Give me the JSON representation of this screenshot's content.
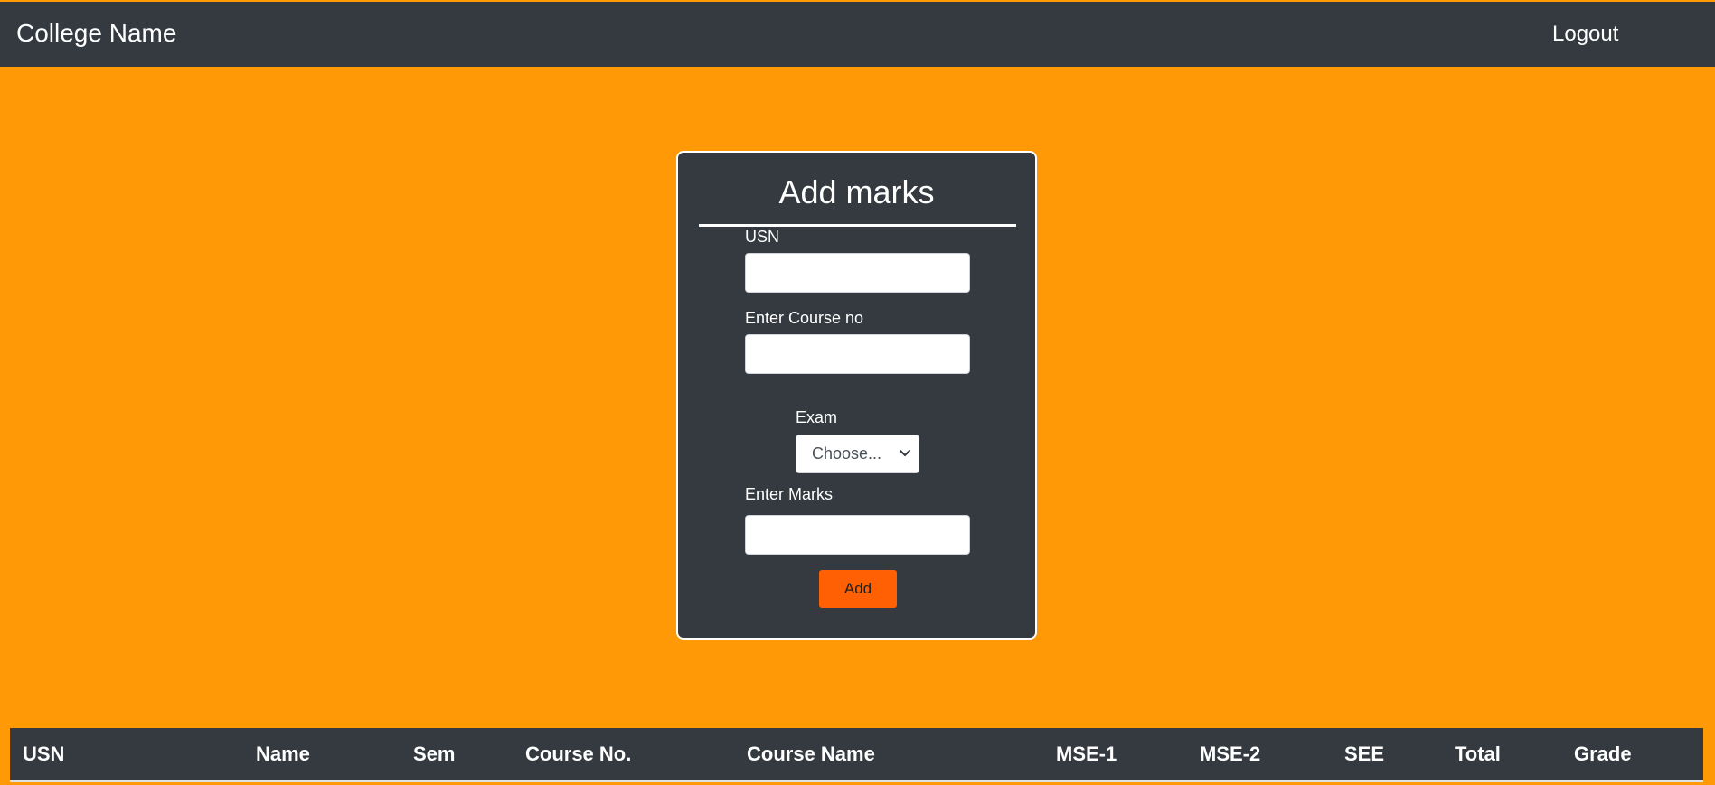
{
  "navbar": {
    "brand": "College Name",
    "logout_label": "Logout"
  },
  "form": {
    "title": "Add marks",
    "usn_label": "USN",
    "usn_value": "",
    "course_label": "Enter Course no",
    "course_value": "",
    "exam_label": "Exam",
    "exam_selected": "Choose...",
    "marks_label": "Enter Marks",
    "marks_value": "",
    "add_label": "Add"
  },
  "table": {
    "columns": [
      "USN",
      "Name",
      "Sem",
      "Course No.",
      "Course Name",
      "MSE-1",
      "MSE-2",
      "SEE",
      "Total",
      "Grade"
    ]
  },
  "icons": {
    "select_caret": "chevron-down-icon"
  },
  "colors": {
    "page_background": "#ff9a06",
    "navbar": "#343a40",
    "card": "#343a40",
    "add_button": "#ff6004",
    "table_header": "#343a40"
  }
}
